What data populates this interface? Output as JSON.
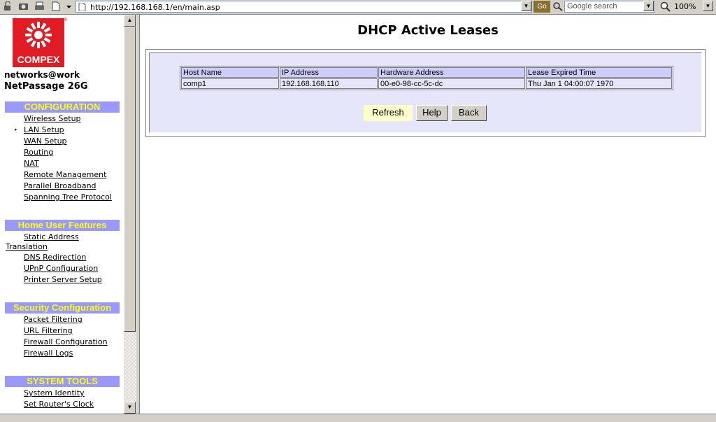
{
  "browser": {
    "address": "http://192.168.168.1/en/main.asp",
    "go_label": "Go",
    "search_placeholder": "Google search",
    "zoom": "100%"
  },
  "sidebar": {
    "logo_text": "COMPEX",
    "reg_mark": "®",
    "tagline": "networks@work",
    "model": "NetPassage 26G",
    "sections": [
      {
        "title": "CONFIGURATION",
        "items": [
          "Wireless Setup",
          "LAN Setup",
          "WAN Setup",
          "Routing",
          "NAT",
          "Remote Management",
          "Parallel Broadband",
          "Spanning Tree Protocol"
        ]
      },
      {
        "title": "Home User Features",
        "items": [
          "Static Address Translation",
          "DNS Redirection",
          "UPnP Configuration",
          "Printer Server Setup"
        ]
      },
      {
        "title": "Security Configuration",
        "items": [
          "Packet Filtering",
          "URL Filtering",
          "Firewall Configuration",
          "Firewall Logs"
        ]
      },
      {
        "title": "SYSTEM TOOLS",
        "items": [
          "System Identity",
          "Set Router's Clock"
        ]
      }
    ],
    "active_bullet": "▸",
    "colors": {
      "section_bg": "#9999ff",
      "section_text": "#ffff00",
      "logo": "#e11c24"
    }
  },
  "main": {
    "title": "DHCP Active Leases",
    "table": {
      "headers": [
        "Host Name",
        "IP Address",
        "Hardware Address",
        "Lease Expired Time"
      ],
      "rows": [
        [
          "comp1",
          "192.168.168.110",
          "00-e0-98-cc-5c-dc",
          "Thu Jan 1 04:00:07 1970"
        ]
      ]
    },
    "buttons": {
      "refresh": "Refresh",
      "help": "Help",
      "back": "Back"
    },
    "colors": {
      "panel_bg": "#e6e6fa",
      "header_bg": "#ccccff",
      "refresh_bg": "#ffffcc"
    }
  }
}
